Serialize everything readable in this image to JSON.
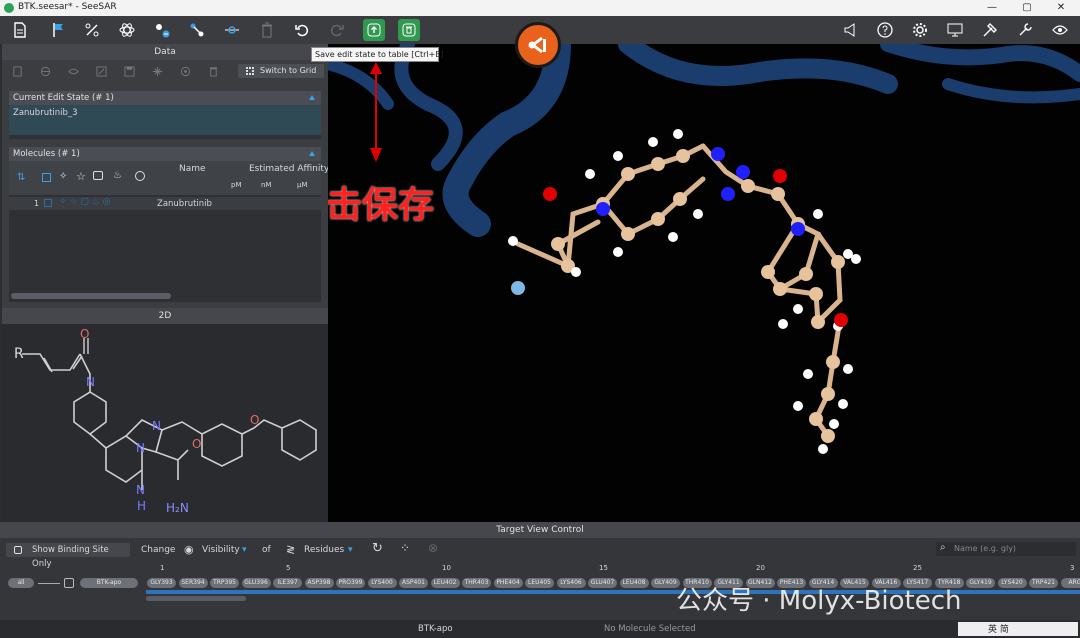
{
  "window": {
    "title": "BTK.seesar* - SeeSAR",
    "min": "—",
    "max": "▢",
    "close": "✕"
  },
  "tooltip": "Save edit state to table [Ctrl+E]",
  "annotation": "点击保存",
  "data_panel": {
    "header": "Data",
    "switch_label": "Switch to Grid",
    "edit_state": {
      "title": "Current Edit State (# 1)",
      "value": "Zanubrutinib_3"
    },
    "molecules": {
      "title": "Molecules (# 1)",
      "col_name": "Name",
      "col_affinity": "Estimated Affinity",
      "units": [
        "pM",
        "nM",
        "µM"
      ],
      "rows": [
        {
          "index": "1",
          "name": "Zanubrutinib"
        }
      ]
    }
  },
  "panel_2d": {
    "header": "2D",
    "atoms": {
      "r": "R",
      "o1": "O",
      "n1": "N",
      "n2": "N",
      "n3": "N",
      "o2": "O",
      "nh": "N",
      "h": "H",
      "o3": "O",
      "h2n": "H₂N"
    }
  },
  "target_view": {
    "header": "Target View Control",
    "show_binding_site": "Show Binding Site Only",
    "change": "Change",
    "visibility": "Visibility",
    "of": "of",
    "residues": "Residues",
    "search_placeholder": "Name (e.g. gly)",
    "all": "all",
    "chain": "BTK-apo",
    "ruler": [
      "1",
      "5",
      "10",
      "15",
      "20",
      "25",
      "3"
    ],
    "residues_list": [
      "GLY393",
      "SER394",
      "TRP395",
      "GLU396",
      "ILE397",
      "ASP398",
      "PRO399",
      "LYS400",
      "ASP401",
      "LEU402",
      "THR403",
      "PHE404",
      "LEU405",
      "LYS406",
      "GLU407",
      "LEU408",
      "GLY409",
      "THR410",
      "GLY411",
      "GLN412",
      "PHE413",
      "GLY414",
      "VAL415",
      "VAL416",
      "LYS417",
      "TYR418",
      "GLY419",
      "LYS420",
      "TRP421",
      "ARG"
    ]
  },
  "status": {
    "left": "BTK-apo",
    "right": "No Molecule Selected"
  },
  "watermark": "公众号 · Molyx-Biotech",
  "ime": "英 简"
}
